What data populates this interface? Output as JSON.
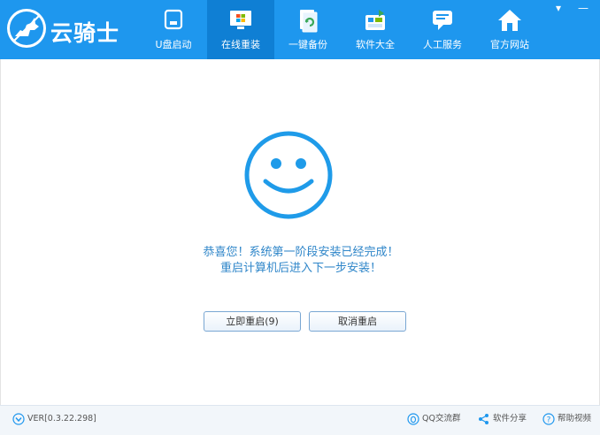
{
  "app": {
    "logo_text": "云骑士",
    "logo_icon": "knight-logo-icon"
  },
  "nav": [
    {
      "label": "U盘启动",
      "icon": "usb-drive-icon",
      "active": false
    },
    {
      "label": "在线重装",
      "icon": "windows-monitor-icon",
      "active": true
    },
    {
      "label": "一键备份",
      "icon": "backup-refresh-icon",
      "active": false
    },
    {
      "label": "软件大全",
      "icon": "software-box-icon",
      "active": false
    },
    {
      "label": "人工服务",
      "icon": "chat-bubble-icon",
      "active": false
    },
    {
      "label": "官方网站",
      "icon": "home-icon",
      "active": false
    }
  ],
  "window_controls": {
    "minimize": "▾",
    "close": "—"
  },
  "main": {
    "status_icon": "smiley-face-icon",
    "message_line1": "恭喜您！系统第一阶段安装已经完成！",
    "message_line2": "重启计算机后进入下一步安装！",
    "restart_button": "立即重启(9)",
    "cancel_button": "取消重启"
  },
  "statusbar": {
    "version": "VER[0.3.22.298]",
    "qq_group": "QQ交流群",
    "share": "软件分享",
    "help_video": "帮助视频"
  },
  "colors": {
    "header": "#1e97ee",
    "active_tab": "#0f7fd4",
    "accent_text": "#2f86c9",
    "smiley": "#1f9be9"
  }
}
